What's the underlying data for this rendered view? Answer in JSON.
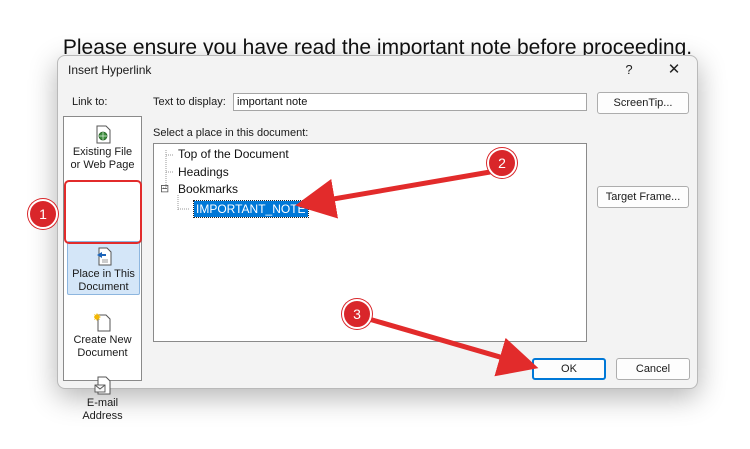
{
  "document": {
    "sentence": "Please ensure you have read the important note before proceeding."
  },
  "dialog": {
    "title": "Insert Hyperlink",
    "help_label": "?",
    "close_label": "✕",
    "link_to_label": "Link to:",
    "text_to_display_label": "Text to display:",
    "text_to_display_value": "important note",
    "screentip_label": "ScreenTip...",
    "select_place_label": "Select a place in this document:",
    "target_frame_label": "Target Frame...",
    "ok_label": "OK",
    "cancel_label": "Cancel"
  },
  "sidebar": {
    "items": [
      {
        "line1": "Existing File",
        "line2": "or Web Page",
        "icon": "globe-file-icon"
      },
      {
        "line1": "Place in This",
        "line2": "Document",
        "icon": "document-place-icon",
        "selected": true
      },
      {
        "line1": "Create New",
        "line2": "Document",
        "icon": "new-document-icon"
      },
      {
        "line1": "E-mail",
        "line2": "Address",
        "icon": "email-icon"
      }
    ]
  },
  "tree": {
    "items": [
      {
        "label": "Top of the Document"
      },
      {
        "label": "Headings"
      },
      {
        "label": "Bookmarks",
        "expander": "⊟"
      },
      {
        "label": "IMPORTANT_NOTE",
        "selected": true
      }
    ]
  },
  "callouts": [
    "1",
    "2",
    "3"
  ],
  "colors": {
    "accent": "#0078d7",
    "annotation_red": "#e22b2b",
    "dialog_bg": "#f3f3f3"
  }
}
